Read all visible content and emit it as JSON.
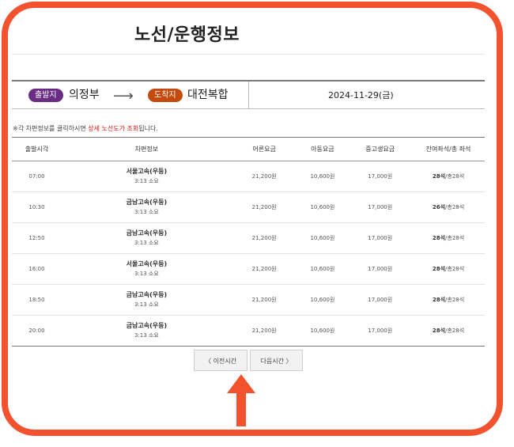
{
  "page": {
    "title": "노선/운행정보"
  },
  "route": {
    "departure_badge": "출발지",
    "departure": "의정부",
    "arrow": "⟶",
    "arrival_badge": "도착지",
    "arrival": "대전복합",
    "date": "2024-11-29(금)"
  },
  "notice": {
    "prefix": "※각 차편정보를 클릭하시면 ",
    "highlight": "상세 노선도가 조회",
    "suffix": "됩니다."
  },
  "table": {
    "headers": {
      "time": "출발시각",
      "info": "차편정보",
      "adult": "어른요금",
      "child": "아동요금",
      "student": "중고생요금",
      "seats": "잔여좌석/총 좌석"
    },
    "rows": [
      {
        "time": "07:00",
        "company": "서울고속(우등)",
        "duration": "3:13 소요",
        "adult": "21,200원",
        "child": "10,600원",
        "student": "17,000원",
        "seats_left": "28석",
        "seats_total": "/총28석"
      },
      {
        "time": "10:30",
        "company": "금남고속(우등)",
        "duration": "3:13 소요",
        "adult": "21,200원",
        "child": "10,600원",
        "student": "17,000원",
        "seats_left": "26석",
        "seats_total": "/총28석"
      },
      {
        "time": "12:50",
        "company": "금남고속(우등)",
        "duration": "3:13 소요",
        "adult": "21,200원",
        "child": "10,600원",
        "student": "17,000원",
        "seats_left": "28석",
        "seats_total": "/총28석"
      },
      {
        "time": "16:00",
        "company": "서울고속(우등)",
        "duration": "3:13 소요",
        "adult": "21,200원",
        "child": "10,600원",
        "student": "17,000원",
        "seats_left": "28석",
        "seats_total": "/총28석"
      },
      {
        "time": "18:50",
        "company": "금남고속(우등)",
        "duration": "3:13 소요",
        "adult": "21,200원",
        "child": "10,600원",
        "student": "17,000원",
        "seats_left": "28석",
        "seats_total": "/총28석"
      },
      {
        "time": "20:00",
        "company": "금남고속(우등)",
        "duration": "3:13 소요",
        "adult": "21,200원",
        "child": "10,600원",
        "student": "17,000원",
        "seats_left": "28석",
        "seats_total": "/총28석"
      }
    ]
  },
  "pagination": {
    "prev": "〈 이전시간",
    "next": "다음시간 〉"
  },
  "colors": {
    "frame": "#f2522e",
    "departure_badge": "#6a2c84",
    "arrival_badge": "#c44a0e",
    "highlight": "#d11111",
    "arrow": "#f2522e"
  },
  "icons": {
    "route_arrow": "right-arrow-icon",
    "callout": "up-arrow-icon"
  }
}
